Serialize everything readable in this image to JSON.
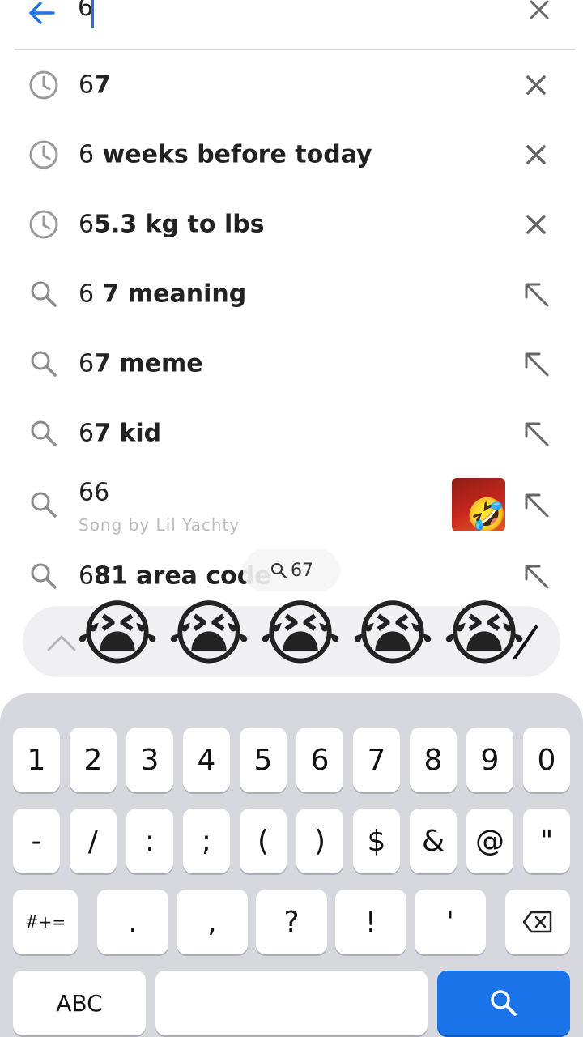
{
  "search": {
    "query": "6",
    "bubble": "67"
  },
  "suggestions": [
    {
      "icon": "history-icon",
      "prefix": "6",
      "rest": "7",
      "action": "remove-icon"
    },
    {
      "icon": "history-icon",
      "prefix": "6",
      "rest": " weeks before today",
      "action": "remove-icon"
    },
    {
      "icon": "history-icon",
      "prefix": "6",
      "rest": "5.3 kg to lbs",
      "action": "remove-icon"
    },
    {
      "icon": "search-icon",
      "prefix": "6",
      "rest": " 7 meaning",
      "action": "fill-arrow-icon"
    },
    {
      "icon": "search-icon",
      "prefix": "6",
      "rest": "7 meme",
      "action": "fill-arrow-icon"
    },
    {
      "icon": "search-icon",
      "prefix": "6",
      "rest": "7 kid",
      "action": "fill-arrow-icon"
    },
    {
      "icon": "search-icon",
      "prefix": "6",
      "rest": "6",
      "subtitle": "Song by Lil Yachty",
      "action": "fill-arrow-icon"
    },
    {
      "icon": "search-icon",
      "prefix": "6",
      "rest": "81 area code",
      "action": "fill-arrow-icon"
    }
  ],
  "emoji_bar": {
    "emojis": [
      "😭",
      "😭",
      "😭",
      "😭",
      "😭"
    ]
  },
  "album_emoji": "🤣",
  "keyboard": {
    "row1": [
      "1",
      "2",
      "3",
      "4",
      "5",
      "6",
      "7",
      "8",
      "9",
      "0"
    ],
    "row2": [
      "-",
      "/",
      ":",
      ";",
      "(",
      ")",
      "$",
      "&",
      "@",
      "\""
    ],
    "row3": [
      ".",
      ",",
      "?",
      "!",
      "'"
    ],
    "symbols_label": "#+=",
    "abc_label": "ABC"
  },
  "colors": {
    "accent": "#1a73e8",
    "keyboard_bg": "#d6d8de"
  }
}
